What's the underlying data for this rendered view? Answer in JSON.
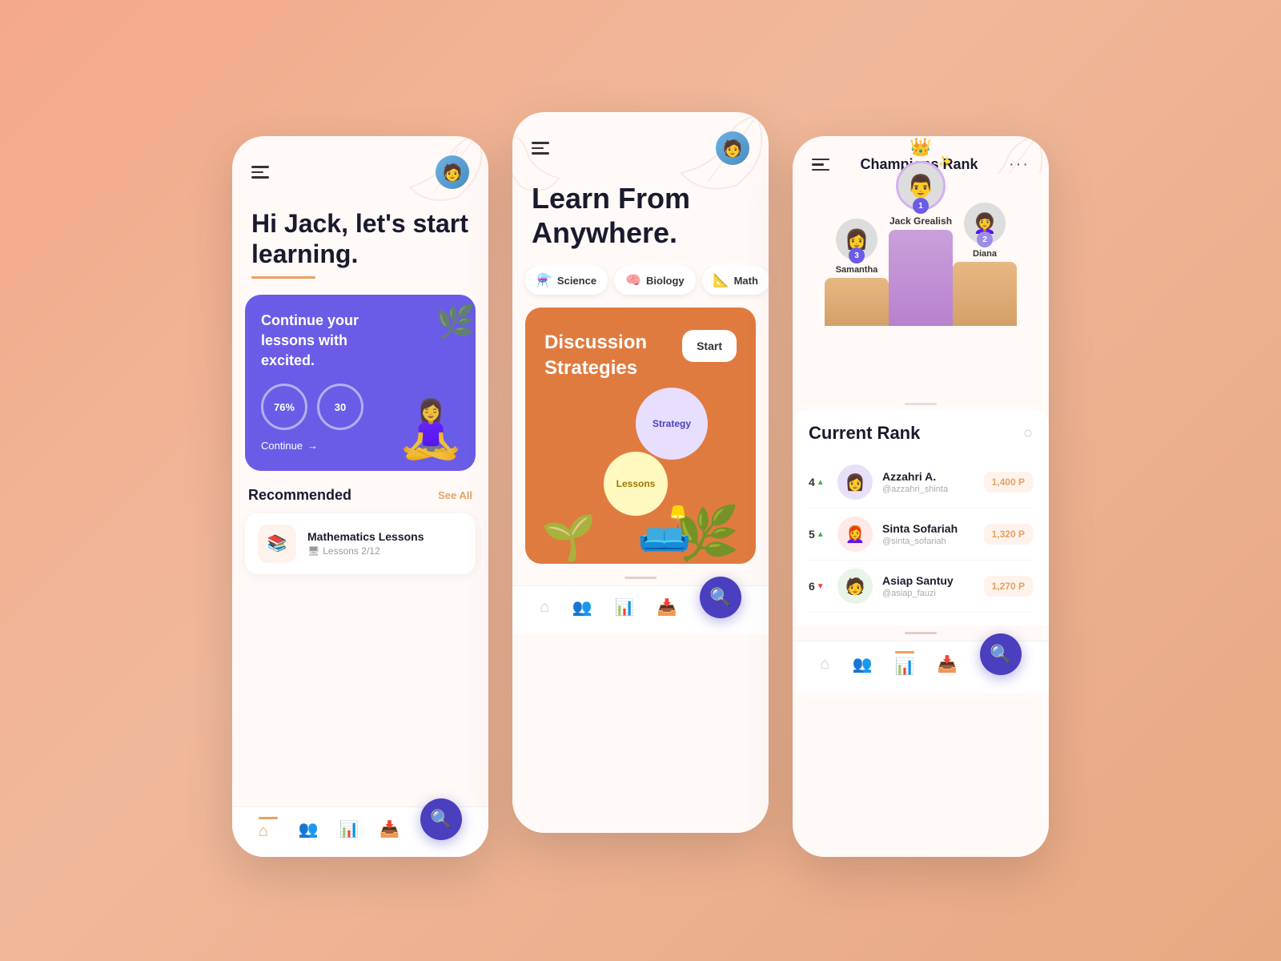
{
  "background": "#f4a98a",
  "phone1": {
    "greeting": "Hi Jack, let's start learning.",
    "card": {
      "text": "Continue your lessons with excited.",
      "stat1": "76%",
      "stat2": "30",
      "continue": "Continue"
    },
    "recommended": "Recommended",
    "seeAll": "See All",
    "lesson": {
      "title": "Mathematics Lessons",
      "sub": "Lessons 2/12"
    },
    "navItems": [
      "home",
      "add-user",
      "leaderboard",
      "inbox"
    ]
  },
  "phone2": {
    "title": "Learn From Anywhere.",
    "categories": [
      {
        "icon": "⚗️",
        "label": "Science"
      },
      {
        "icon": "🧠",
        "label": "Biology"
      },
      {
        "icon": "📐",
        "label": "Math"
      }
    ],
    "card": {
      "title": "Discussion Strategies",
      "startLabel": "Start",
      "bubble1": "Strategy",
      "bubble2": "Lessons"
    }
  },
  "phone3": {
    "headerTitle": "Champions Rank",
    "podium": [
      {
        "rank": 3,
        "name": "Samantha",
        "emoji": "👩"
      },
      {
        "rank": 1,
        "name": "Jack Grealish",
        "emoji": "👨"
      },
      {
        "rank": 2,
        "name": "Diana",
        "emoji": "👩‍🦱"
      }
    ],
    "currentRankTitle": "Current Rank",
    "rankRows": [
      {
        "rank": 4,
        "trend": "up",
        "name": "Azzahri A.",
        "handle": "@azzahri_shinta",
        "points": "1,400 P",
        "emoji": "👩"
      },
      {
        "rank": 5,
        "trend": "up",
        "name": "Sinta Sofariah",
        "handle": "@sinta_sofariah",
        "points": "1,320 P",
        "emoji": "👩‍🦰"
      },
      {
        "rank": 6,
        "trend": "down",
        "name": "Asiap Santuy",
        "handle": "@asiap_fauzi",
        "points": "1,270 P",
        "emoji": "🧑"
      }
    ]
  }
}
